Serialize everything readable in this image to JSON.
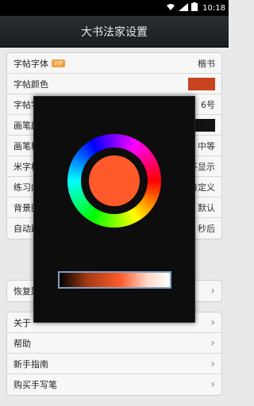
{
  "status_bar": {
    "time": "10:18"
  },
  "title": "大书法家设置",
  "settings": [
    {
      "label": "字帖字体",
      "badge": "VIP",
      "value": "楷书"
    },
    {
      "label": "字帖颜色",
      "swatch": "#c8441e"
    },
    {
      "label": "字帖字号",
      "value": "6号"
    },
    {
      "label": "画笔颜色",
      "swatch": "#111111"
    },
    {
      "label": "画笔粗细",
      "value": "中等"
    },
    {
      "label": "米字格",
      "value": "不显示"
    },
    {
      "label": "练习内容",
      "value": "自定义"
    },
    {
      "label": "背景图片",
      "value": "默认"
    },
    {
      "label": "自动跳到下一字",
      "value": "秒后"
    }
  ],
  "restore": {
    "label": "恢复默认设置"
  },
  "links": [
    {
      "label": "关于"
    },
    {
      "label": "帮助"
    },
    {
      "label": "新手指南"
    },
    {
      "label": "购买手写笔"
    }
  ],
  "color_picker": {
    "selected_color": "#ff5a2a"
  }
}
